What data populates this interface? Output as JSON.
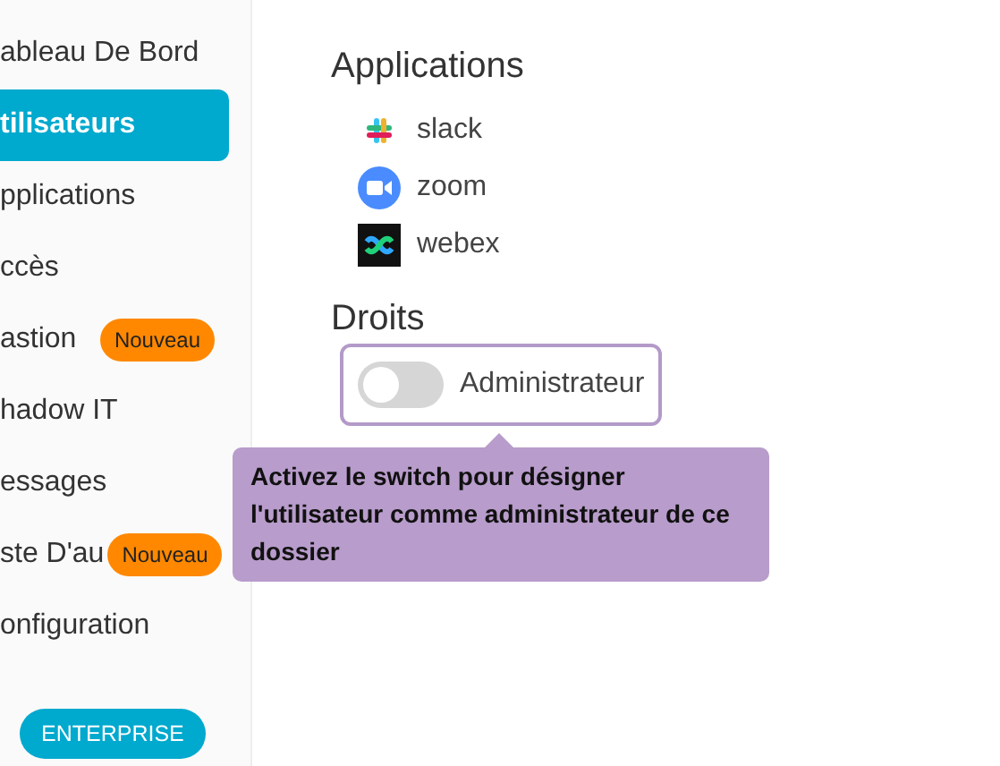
{
  "sidebar": {
    "items": [
      {
        "label": "ableau De Bord",
        "selected": false
      },
      {
        "label": "tilisateurs",
        "selected": true
      },
      {
        "label": "pplications",
        "selected": false
      },
      {
        "label": "ccès",
        "selected": false
      },
      {
        "label": "astion",
        "selected": false,
        "badge": "Nouveau"
      },
      {
        "label": "hadow IT",
        "selected": false
      },
      {
        "label": "essages",
        "selected": false
      },
      {
        "label": "ste D'au",
        "selected": false,
        "badge": "Nouveau"
      },
      {
        "label": "onfiguration",
        "selected": false
      }
    ],
    "plan_badge": "ENTERPRISE"
  },
  "applications": {
    "title": "Applications",
    "items": [
      {
        "name": "slack",
        "kind": "slack"
      },
      {
        "name": "zoom",
        "kind": "zoom"
      },
      {
        "name": "webex",
        "kind": "webex"
      }
    ]
  },
  "rights": {
    "title": "Droits",
    "switch": {
      "label": "Administrateur",
      "on": false
    },
    "tooltip": "Activez le switch pour désigner l'utilisateur comme administrateur de ce dossier"
  }
}
